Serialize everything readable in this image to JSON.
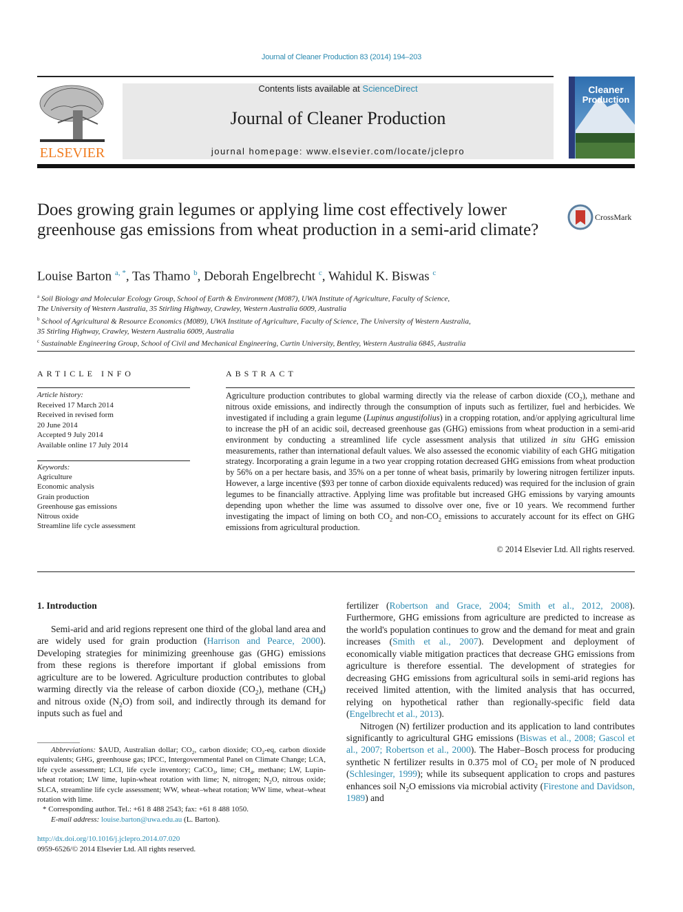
{
  "running_head": "Journal of Cleaner Production 83 (2014) 194–203",
  "masthead": {
    "contents_prefix": "Contents lists available at ",
    "contents_link": "ScienceDirect",
    "journal_name": "Journal of Cleaner Production",
    "homepage": "journal homepage: www.elsevier.com/locate/jclepro",
    "publisher_logo_text": "ELSEVIER",
    "cover_title_line1": "Cleaner",
    "cover_title_line2": "Production",
    "publisher_color": "#f07b1d",
    "link_color": "#2a8ab0"
  },
  "article": {
    "title": "Does growing grain legumes or applying lime cost effectively lower greenhouse gas emissions from wheat production in a semi-arid climate?",
    "crossmark_label": "CrossMark",
    "authors": [
      {
        "name": "Louise Barton",
        "sup": "a, *"
      },
      {
        "name": "Tas Thamo",
        "sup": "b"
      },
      {
        "name": "Deborah Engelbrecht",
        "sup": "c"
      },
      {
        "name": "Wahidul K. Biswas",
        "sup": "c"
      }
    ],
    "affiliations": [
      {
        "sup": "a",
        "line1": "Soil Biology and Molecular Ecology Group, School of Earth & Environment (M087), UWA Institute of Agriculture, Faculty of Science,",
        "line2": "The University of Western Australia, 35 Stirling Highway, Crawley, Western Australia 6009, Australia"
      },
      {
        "sup": "b",
        "line1": "School of Agricultural & Resource Economics (M089), UWA Institute of Agriculture, Faculty of Science, The University of Western Australia,",
        "line2": "35 Stirling Highway, Crawley, Western Australia 6009, Australia"
      },
      {
        "sup": "c",
        "line1": "Sustainable Engineering Group, School of Civil and Mechanical Engineering, Curtin University, Bentley, Western Australia 6845, Australia",
        "line2": ""
      }
    ]
  },
  "article_info": {
    "heading": "ARTICLE INFO",
    "history_label": "Article history:",
    "history": [
      "Received 17 March 2014",
      "Received in revised form",
      "20 June 2014",
      "Accepted 9 July 2014",
      "Available online 17 July 2014"
    ],
    "keywords_label": "Keywords:",
    "keywords": [
      "Agriculture",
      "Economic analysis",
      "Grain production",
      "Greenhouse gas emissions",
      "Nitrous oxide",
      "Streamline life cycle assessment"
    ]
  },
  "abstract": {
    "heading": "ABSTRACT",
    "p1": "Agriculture production contributes to global warming directly via the release of carbon dioxide (CO",
    "p2": "), methane and nitrous oxide emissions, and indirectly through the consumption of inputs such as fertilizer, fuel and herbicides. We investigated if including a grain legume (",
    "species": "Lupinus angustifolius",
    "p3": ") in a cropping rotation, and/or applying agricultural lime to increase the pH of an acidic soil, decreased greenhouse gas (GHG) emissions from wheat production in a semi-arid environment by conducting a streamlined life cycle assessment analysis that utilized ",
    "in_situ": "in situ",
    "p4": " GHG emission measurements, rather than international default values. We also assessed the economic viability of each GHG mitigation strategy. Incorporating a grain legume in a two year cropping rotation decreased GHG emissions from wheat production by 56% on a per hectare basis, and 35% on a per tonne of wheat basis, primarily by lowering nitrogen fertilizer inputs. However, a large incentive ($93 per tonne of carbon dioxide equivalents reduced) was required for the inclusion of grain legumes to be financially attractive. Applying lime was profitable but increased GHG emissions by varying amounts depending upon whether the lime was assumed to dissolve over one, five or 10 years. We recommend further investigating the impact of liming on both CO",
    "p5": " and non-CO",
    "p6": " emissions to accurately account for its effect on GHG emissions from agricultural production.",
    "sub2": "2",
    "copyright": "© 2014 Elsevier Ltd. All rights reserved."
  },
  "intro": {
    "heading": "1.  Introduction",
    "left": {
      "a": "Semi-arid and arid regions represent one third of the global land area and are widely used for grain production (",
      "ref1": "Harrison and Pearce, 2000",
      "b": "). Developing strategies for minimizing greenhouse gas (GHG) emissions from these regions is therefore important if global emissions from agriculture are to be lowered. Agriculture production contributes to global warming directly via the release of carbon dioxide (CO",
      "c": "), methane (CH",
      "d": ") and nitrous oxide (N",
      "e": "O) from soil, and indirectly through its demand for inputs such as fuel and",
      "sub2": "2",
      "sub4": "4"
    },
    "right": {
      "a": "fertilizer (",
      "ref1": "Robertson and Grace, 2004; Smith et al., 2012, 2008",
      "b": "). Furthermore, GHG emissions from agriculture are predicted to increase as the world's population continues to grow and the demand for meat and grain increases (",
      "ref2": "Smith et al., 2007",
      "c": "). Development and deployment of economically viable mitigation practices that decrease GHG emissions from agriculture is therefore essential. The development of strategies for decreasing GHG emissions from agricultural soils in semi-arid regions has received limited attention, with the limited analysis that has occurred, relying on hypothetical rather than regionally-specific field data (",
      "ref3": "Engelbrecht et al., 2013",
      "d": ").",
      "p2a": "Nitrogen (N) fertilizer production and its application to land contributes significantly to agricultural GHG emissions (",
      "ref4": "Biswas et al., 2008; Gascol et al., 2007; Robertson et al., 2000",
      "p2b": "). The Haber–Bosch process for producing synthetic N fertilizer results in 0.375 mol of CO",
      "p2c": " per mole of N produced (",
      "ref5": "Schlesinger, 1999",
      "p2d": "); while its subsequent application to crops and pastures enhances soil N",
      "p2e": "O emissions via microbial activity (",
      "ref6": "Firestone and Davidson, 1989",
      "p2f": ") and",
      "sub2": "2"
    }
  },
  "footnotes": {
    "abbrev_label": "Abbreviations:",
    "abbrev_a": " $AUD, Australian dollar; CO",
    "abbrev_b": ", carbon dioxide; CO",
    "abbrev_c": "-eq, carbon dioxide equivalents; GHG, greenhouse gas; IPCC, Intergovernmental Panel on Climate Change; LCA, life cycle assessment; LCI, life cycle inventory; CaCO",
    "abbrev_d": ", lime; CH",
    "abbrev_e": ", methane; LW, Lupin-wheat rotation; LW lime, lupin-wheat rotation with lime; N, nitrogen; N",
    "abbrev_f": "O, nitrous oxide; SLCA, streamline life cycle assessment; WW, wheat–wheat rotation; WW lime, wheat–wheat rotation with lime.",
    "sub2": "2",
    "sub3": "3",
    "sub4": "4",
    "corresponding": "* Corresponding author. Tel.: +61 8 488 2543; fax: +61 8 488 1050.",
    "email_label": "E-mail address:",
    "email": "louise.barton@uwa.edu.au",
    "email_suffix": " (L. Barton).",
    "doi": "http://dx.doi.org/10.1016/j.jclepro.2014.07.020",
    "issn": "0959-6526/© 2014 Elsevier Ltd. All rights reserved."
  }
}
